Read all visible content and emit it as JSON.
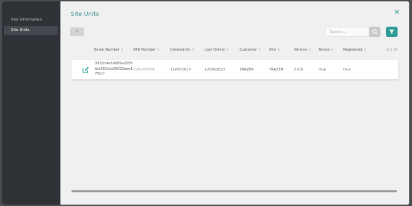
{
  "sidebar": {
    "items": [
      {
        "label": "Site Information",
        "active": false
      },
      {
        "label": "Site Units",
        "active": true
      }
    ]
  },
  "main": {
    "title": "Site Units",
    "close_icon": "close-icon",
    "add_icon": "plus-icon",
    "search": {
      "placeholder": "Search...",
      "value": ""
    },
    "search_icon": "search-icon",
    "filter_icon": "filter-icon",
    "pagination": "1-1 of",
    "columns": [
      "Serial Number",
      "SKU Number",
      "Created On",
      "Last Online",
      "Customer",
      "Site",
      "Version",
      "Active",
      "Registered"
    ],
    "rows": [
      {
        "serial_number": "3332c4e7a665a2055bfa562fca05633aee17f0c7",
        "sku_number": "TZR-000000",
        "created_on": "11/07/2023",
        "last_online": "12/06/2023",
        "customer": "TRAZER",
        "site": "TRAZER",
        "version": "2.0.6",
        "active": "true",
        "registered": "true"
      }
    ]
  },
  "colors": {
    "accent": "#2e9c94",
    "sidebar_bg": "#2f3237",
    "title": "#2b8c86"
  }
}
